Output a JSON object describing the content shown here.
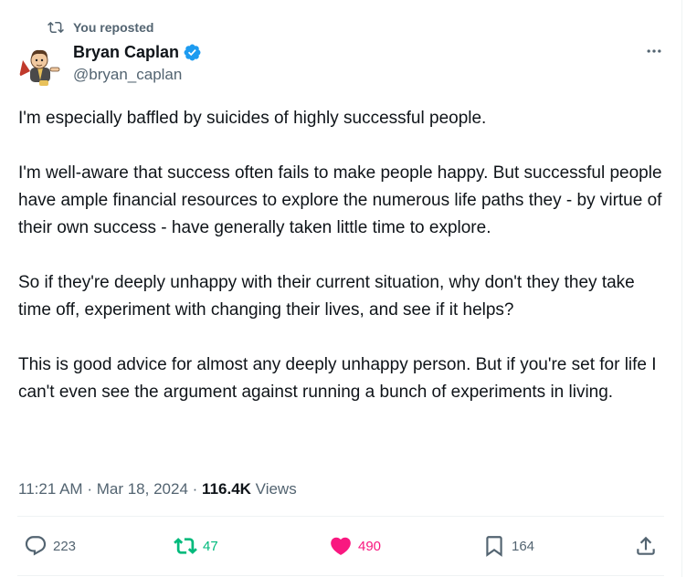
{
  "repost_banner": {
    "text": "You reposted",
    "icon": "retweet-icon"
  },
  "author": {
    "display_name": "Bryan Caplan",
    "handle": "@bryan_caplan",
    "verified": true,
    "avatar": "cartoon-superhero-avatar"
  },
  "tweet": {
    "paragraphs": [
      "I'm especially baffled by suicides of highly successful people.",
      "I'm well-aware that success often fails to make people happy. But successful people have ample financial resources to explore the numerous life paths they - by virtue of their own success - have generally taken little time to explore.",
      "So if they're deeply unhappy with their current situation, why don't they they take time off, experiment with changing their lives, and see if it helps?",
      "This is good advice for almost any deeply unhappy person. But if you're set for life I can't even see the argument against running a bunch of experiments in living."
    ]
  },
  "meta": {
    "time": "11:21 AM",
    "separator": "·",
    "date": "Mar 18, 2024",
    "views_count": "116.4K",
    "views_label": "Views"
  },
  "actions": {
    "replies": "223",
    "reposts": "47",
    "likes": "490",
    "bookmarks": "164"
  },
  "colors": {
    "text_primary": "#0f1419",
    "text_secondary": "#536471",
    "verified_blue": "#1d9bf0",
    "retweet_green": "#00ba7c",
    "like_pink": "#f91880",
    "divider": "#eff3f4"
  }
}
